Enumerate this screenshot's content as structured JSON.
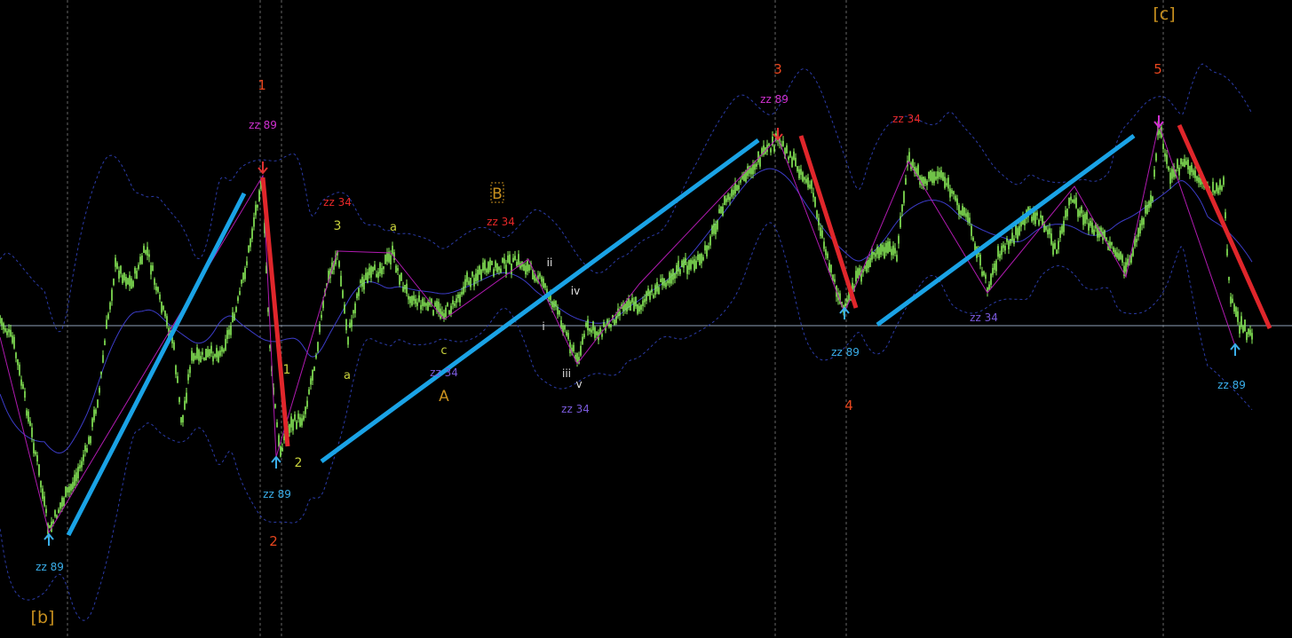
{
  "chart_data": {
    "type": "candlestick",
    "title": "",
    "xlabel": "",
    "ylabel": "",
    "grid": false,
    "colors": {
      "background": "#000000",
      "candles": "#8cf25a",
      "zigzag": "#b01ab0",
      "moving_average": "#3c3cc8",
      "bands": "#2b3ba8",
      "horizontal_level": "#8fa0b8",
      "trend_up": "#1aa3e6",
      "trend_down": "#e0262b",
      "vertical_markers": "#666666"
    },
    "swing_points": [
      {
        "label": "[b]",
        "type": "low"
      },
      {
        "label": "1",
        "type": "high"
      },
      {
        "label": "2",
        "type": "low"
      },
      {
        "label": "3",
        "type": "high"
      },
      {
        "label": "4",
        "type": "low"
      },
      {
        "label": "5",
        "type": "high"
      },
      {
        "label": "zz 89",
        "type": "low"
      }
    ],
    "annotations": {
      "wave_major": [
        "1",
        "2",
        "3",
        "4",
        "5"
      ],
      "wave_degree": [
        "[b]",
        "[c]"
      ],
      "wave_abc": [
        "A",
        "B"
      ],
      "wave_minor": [
        "1",
        "2",
        "3",
        "a",
        "a",
        "c"
      ],
      "wave_minute": [
        "i",
        "ii",
        "iii",
        "iv",
        "v"
      ],
      "zigzag_89": [
        "zz 89",
        "zz 89",
        "zz 89",
        "zz 89",
        "zz 89",
        "zz 89",
        "zz 89"
      ],
      "zigzag_34": [
        "zz 34",
        "zz 34",
        "zz 34",
        "zz 34",
        "zz 34",
        "zz 34"
      ]
    }
  }
}
